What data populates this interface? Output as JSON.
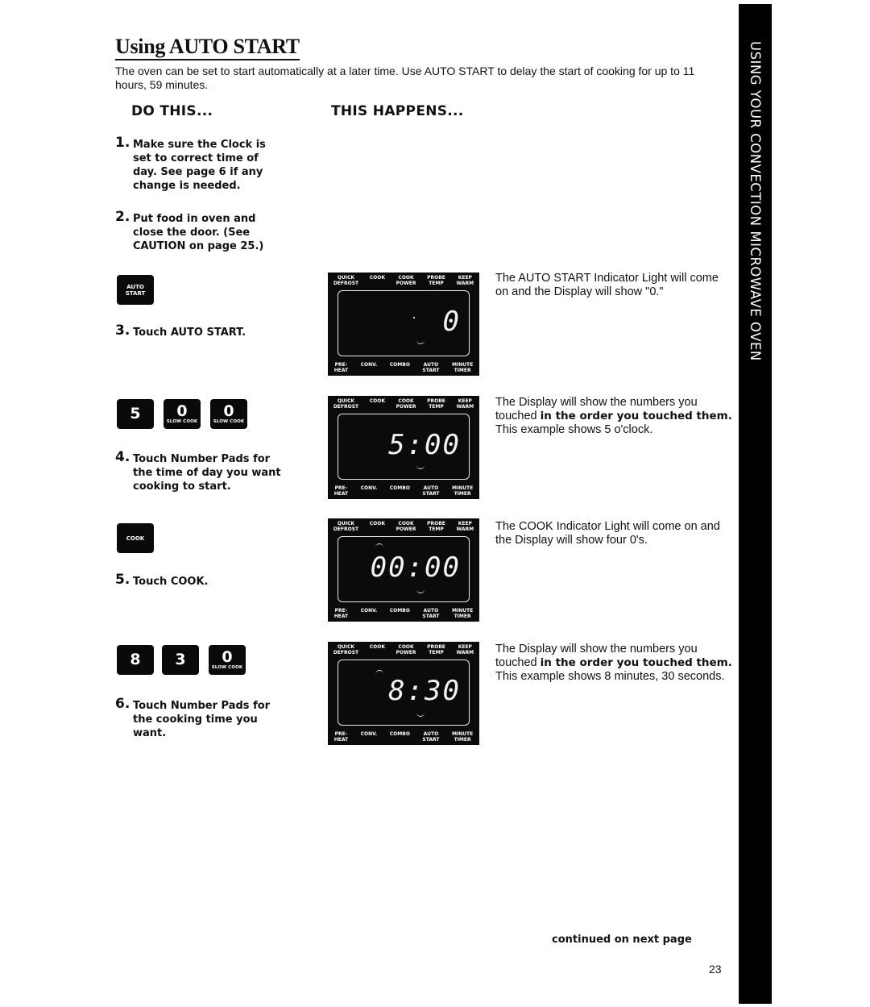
{
  "page": {
    "title": "Using AUTO START",
    "intro": "The oven can be set to start automatically at a later time. Use AUTO START to delay the start of cooking for up to 11 hours, 59 minutes.",
    "column_left_heading": "DO THIS...",
    "column_right_heading": "THIS HAPPENS...",
    "sidebar_label": "USING YOUR CONVECTION MICROWAVE OVEN",
    "continued": "continued on next page",
    "page_number": "23"
  },
  "steps": [
    {
      "number": "1.",
      "text": "Make sure the Clock is set to correct time of day. See page 6 if any change is needed."
    },
    {
      "number": "2.",
      "text": "Put food in oven and close the door. (See CAUTION on page 25.)"
    },
    {
      "number": "3.",
      "text": "Touch AUTO START."
    },
    {
      "number": "4.",
      "text": "Touch Number Pads for the time of day you want cooking to start."
    },
    {
      "number": "5.",
      "text": "Touch COOK."
    },
    {
      "number": "6.",
      "text": "Touch Number Pads for the cooking time you want."
    }
  ],
  "keypads": {
    "auto_start": {
      "line1": "AUTO",
      "line2": "START"
    },
    "cook": {
      "label": "COOK"
    },
    "time_of_day": [
      {
        "digit": "5",
        "sub": ""
      },
      {
        "digit": "0",
        "sub": "SLOW COOK"
      },
      {
        "digit": "0",
        "sub": "SLOW COOK"
      }
    ],
    "cook_time": [
      {
        "digit": "8",
        "sub": ""
      },
      {
        "digit": "3",
        "sub": ""
      },
      {
        "digit": "0",
        "sub": "SLOW COOK"
      }
    ]
  },
  "display_labels": {
    "top": [
      {
        "l1": "QUICK",
        "l2": "DEFROST"
      },
      {
        "l1": "COOK",
        "l2": ""
      },
      {
        "l1": "COOK",
        "l2": "POWER"
      },
      {
        "l1": "PROBE",
        "l2": "TEMP"
      },
      {
        "l1": "KEEP",
        "l2": "WARM"
      }
    ],
    "bottom": [
      {
        "l1": "PRE-",
        "l2": "HEAT"
      },
      {
        "l1": "CONV.",
        "l2": ""
      },
      {
        "l1": "COMBO",
        "l2": ""
      },
      {
        "l1": "AUTO",
        "l2": "START"
      },
      {
        "l1": "MINUTE",
        "l2": "TIMER"
      }
    ]
  },
  "displays": [
    {
      "readout": "0",
      "indicator": "AUTO START"
    },
    {
      "readout": "5:00",
      "indicator": "AUTO START"
    },
    {
      "readout": "00:00",
      "indicator": "COOK, AUTO START"
    },
    {
      "readout": "8:30",
      "indicator": "COOK, AUTO START"
    }
  ],
  "descriptions": [
    {
      "pre": "The AUTO START Indicator Light will come on and the Display will show \"0.\"",
      "bold": "",
      "post": ""
    },
    {
      "pre": "The Display will show the numbers you touched ",
      "bold": "in the order you touched them.",
      "post": " This example shows 5 o'clock."
    },
    {
      "pre": "The COOK Indicator Light will come on and the Display will show four 0's.",
      "bold": "",
      "post": ""
    },
    {
      "pre": "The Display will show the numbers you touched ",
      "bold": "in the order you touched them.",
      "post": " This example shows 8 minutes, 30 seconds."
    }
  ]
}
